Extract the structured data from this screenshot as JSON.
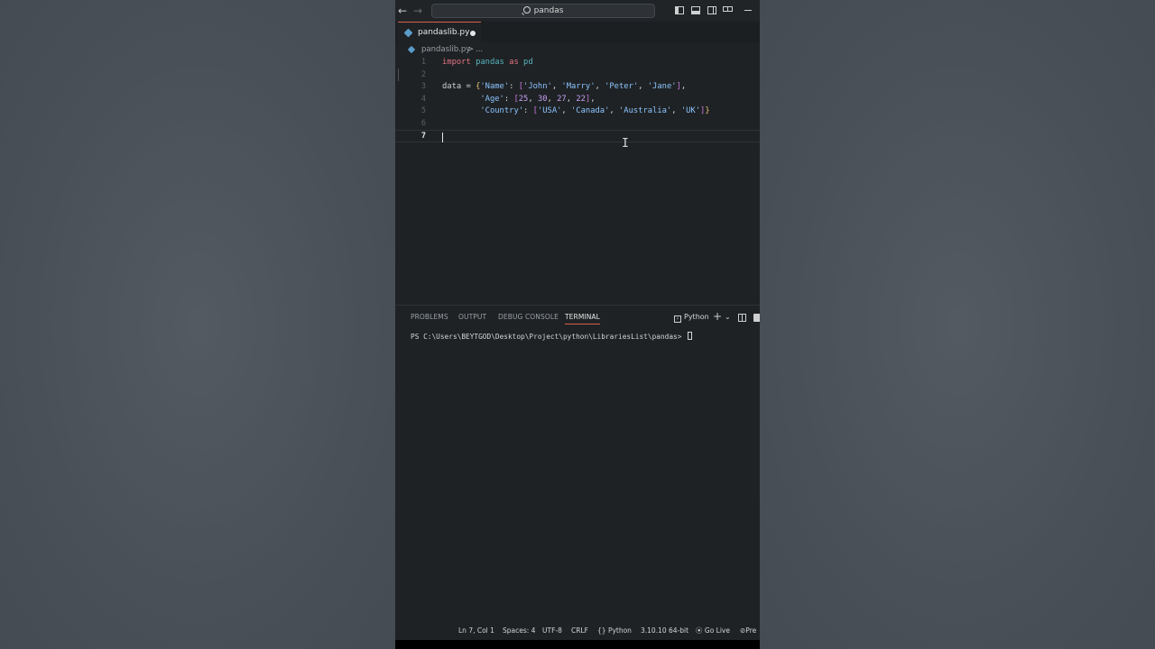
{
  "titlebar": {
    "back_glyph": "←",
    "forward_glyph": "→",
    "search_text": "pandas"
  },
  "tab": {
    "filename": "pandaslib.py"
  },
  "breadcrumb": {
    "file": "pandaslib.py",
    "separator": ">",
    "more": "..."
  },
  "editor": {
    "line_numbers": [
      "1",
      "2",
      "3",
      "4",
      "5",
      "6",
      "7"
    ],
    "active_line": 7,
    "line1": {
      "kw_import": "import",
      "module": "pandas",
      "kw_as": "as",
      "alias": "pd"
    },
    "line3": {
      "var": "data",
      "eq": " = ",
      "open_brace": "{",
      "k_name": "'Name'",
      "colon": ": ",
      "open_bracket": "[",
      "v1": "'John'",
      "v2": "'Marry'",
      "v3": "'Peter'",
      "v4": "'Jane'",
      "close_bracket": "]",
      "comma": ","
    },
    "line4": {
      "k_age": "'Age'",
      "colon": ": ",
      "open_bracket": "[",
      "n1": "25",
      "n2": "30",
      "n3": "27",
      "n4": "22",
      "close_bracket": "]",
      "comma": ","
    },
    "line5": {
      "k_country": "'Country'",
      "colon": ": ",
      "open_bracket": "[",
      "c1": "'USA'",
      "c2": "'Canada'",
      "c3": "'Australia'",
      "c4": "'UK'",
      "close_bracket": "]",
      "close_brace": "}"
    }
  },
  "panel": {
    "tabs": [
      "PROBLEMS",
      "OUTPUT",
      "DEBUG CONSOLE",
      "TERMINAL"
    ],
    "active_tab": "TERMINAL",
    "terminal_profile": "Python",
    "plus_glyph": "+",
    "chevron_glyph": "⌄",
    "prompt": "PS C:\\Users\\BEYTGOD\\Desktop\\Project\\python\\LibrariesList\\pandas>"
  },
  "statusbar": {
    "position": "Ln 7, Col 1",
    "spaces": "Spaces: 4",
    "encoding": "UTF-8",
    "eol": "CRLF",
    "language": "Python",
    "interpreter": "3.10.10 64-bit",
    "go_live": "Go Live",
    "prettier": "Pre"
  },
  "colors": {
    "accent": "#d7604a",
    "keyword": "#e37485",
    "string": "#8ac4ff",
    "number": "#c7a0f5"
  }
}
